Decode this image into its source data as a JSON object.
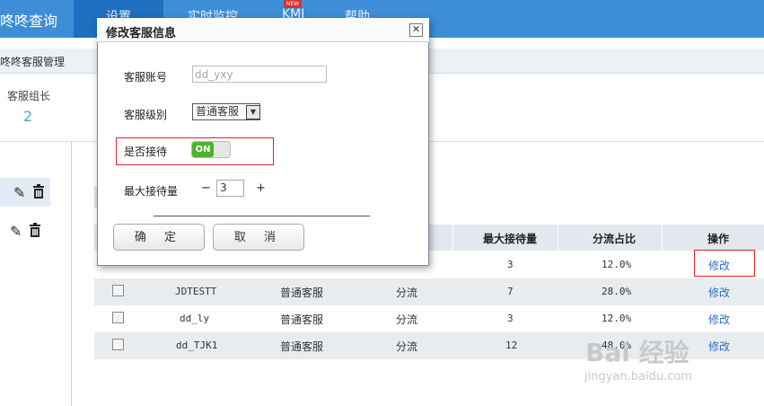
{
  "nav": {
    "brand": "咚咚查询",
    "items": [
      "设置",
      "实时监控",
      "KMI",
      "帮助"
    ],
    "badge": "NEW"
  },
  "breadcrumb": "咚咚客服管理",
  "stats": {
    "label": "客服组长",
    "value": "2"
  },
  "table": {
    "headers": [
      "最大接待量",
      "分流占比",
      "操作"
    ],
    "rows": [
      {
        "account": "JDTESTT",
        "level": "普通客服",
        "mode": "分流",
        "max": "7",
        "ratio": "28.0%",
        "action": "修改"
      },
      {
        "account": "dd_ly",
        "level": "普通客服",
        "mode": "分流",
        "max": "3",
        "ratio": "12.0%",
        "action": "修改"
      },
      {
        "account": "dd_TJK1",
        "level": "普通客服",
        "mode": "分流",
        "max": "12",
        "ratio": "48.0%",
        "action": "修改"
      }
    ],
    "partial_row": {
      "max": "3",
      "ratio": "12.0%",
      "action": "修改"
    }
  },
  "modal": {
    "title": "修改客服信息",
    "close": "✕",
    "account_label": "客服账号",
    "account_value": "dd_yxy",
    "level_label": "客服级别",
    "level_value": "普通客服",
    "receive_label": "是否接待",
    "toggle_text": "ON",
    "max_label": "最大接待量",
    "minus": "−",
    "qty": "3",
    "plus": "+",
    "confirm": "确 定",
    "cancel": "取 消"
  },
  "watermark": {
    "brand": "Bai 经验",
    "url": "jingyan.baidu.com"
  },
  "colors": {
    "nav": "#3d8ed6",
    "nav_active": "#1f6fc0",
    "link": "#2a6fc4",
    "toggle_on": "#4cb32e",
    "highlight": "#dd2222"
  }
}
